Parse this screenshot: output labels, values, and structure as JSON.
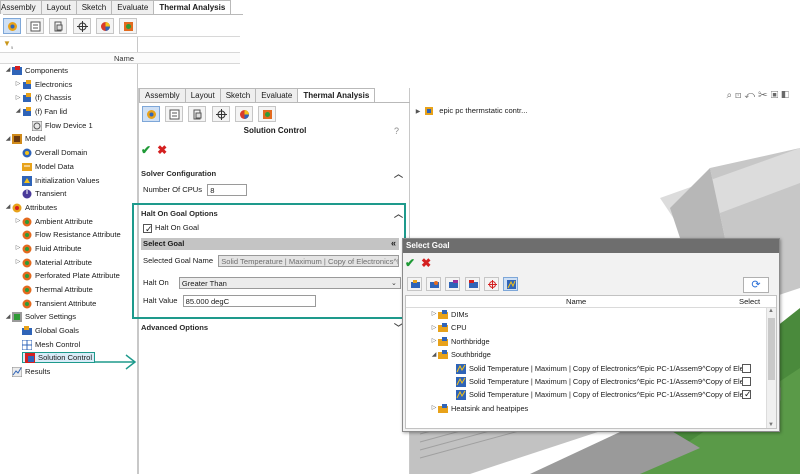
{
  "left_tabs": [
    "Assembly",
    "Layout",
    "Sketch",
    "Evaluate",
    "Thermal Analysis"
  ],
  "left_header": {
    "name_col": "Name"
  },
  "tree": [
    {
      "label": "Components",
      "level": 0,
      "exp": "◢",
      "icon": "components"
    },
    {
      "label": "Electronics",
      "level": 1,
      "exp": "▷",
      "icon": "part"
    },
    {
      "label": "(f) Chassis",
      "level": 1,
      "exp": "▷",
      "icon": "part"
    },
    {
      "label": "(f) Fan lid",
      "level": 1,
      "exp": "◢",
      "icon": "part"
    },
    {
      "label": "Flow Device 1",
      "level": 2,
      "exp": "",
      "icon": "fan"
    },
    {
      "label": "Model",
      "level": 0,
      "exp": "◢",
      "icon": "model"
    },
    {
      "label": "Overall Domain",
      "level": 1,
      "exp": "",
      "icon": "domain"
    },
    {
      "label": "Model Data",
      "level": 1,
      "exp": "",
      "icon": "data"
    },
    {
      "label": "Initialization Values",
      "level": 1,
      "exp": "",
      "icon": "init"
    },
    {
      "label": "Transient",
      "level": 1,
      "exp": "",
      "icon": "transient"
    },
    {
      "label": "Attributes",
      "level": 0,
      "exp": "◢",
      "icon": "attributes"
    },
    {
      "label": "Ambient Attribute",
      "level": 1,
      "exp": "▷",
      "icon": "attr"
    },
    {
      "label": "Flow Resistance Attribute",
      "level": 1,
      "exp": "",
      "icon": "attr"
    },
    {
      "label": "Fluid Attribute",
      "level": 1,
      "exp": "▷",
      "icon": "attr"
    },
    {
      "label": "Material Attribute",
      "level": 1,
      "exp": "▷",
      "icon": "attr"
    },
    {
      "label": "Perforated Plate Attribute",
      "level": 1,
      "exp": "",
      "icon": "attr"
    },
    {
      "label": "Thermal Attribute",
      "level": 1,
      "exp": "",
      "icon": "attr"
    },
    {
      "label": "Transient Attribute",
      "level": 1,
      "exp": "",
      "icon": "attr"
    },
    {
      "label": "Solver Settings",
      "level": 0,
      "exp": "◢",
      "icon": "solver"
    },
    {
      "label": "Global Goals",
      "level": 1,
      "exp": "",
      "icon": "goals"
    },
    {
      "label": "Mesh Control",
      "level": 1,
      "exp": "",
      "icon": "mesh"
    },
    {
      "label": "Solution Control",
      "level": 1,
      "exp": "",
      "icon": "solution",
      "selected": true
    },
    {
      "label": "Results",
      "level": 0,
      "exp": "",
      "icon": "results"
    }
  ],
  "pm": {
    "tabs": [
      "Assembly",
      "Layout",
      "Sketch",
      "Evaluate",
      "Thermal Analysis"
    ],
    "title": "Solution Control",
    "help": "?",
    "solver_config": {
      "heading": "Solver Configuration",
      "cpus_label": "Number Of CPUs",
      "cpus_value": "8"
    },
    "halt": {
      "heading": "Halt On Goal Options",
      "checkbox_label": "Halt On Goal",
      "select_goal_label": "Select Goal",
      "selected_goal_label": "Selected Goal Name",
      "selected_goal_value": "Solid Temperature | Maximum | Copy of Electronics^Epic P",
      "halt_on_label": "Halt On",
      "halt_on_value": "Greater Than",
      "halt_value_label": "Halt Value",
      "halt_value": "85.000 degC"
    },
    "advanced": {
      "heading": "Advanced Options"
    }
  },
  "viewport": {
    "tree_item": "epic pc thermstatic contr..."
  },
  "dialog": {
    "title": "Select Goal",
    "col_name": "Name",
    "col_select": "Select",
    "rows": [
      {
        "label": "DIMs",
        "level": 0,
        "exp": "▷",
        "kind": "folder"
      },
      {
        "label": "CPU",
        "level": 0,
        "exp": "▷",
        "kind": "folder"
      },
      {
        "label": "Northbridge",
        "level": 0,
        "exp": "▷",
        "kind": "folder"
      },
      {
        "label": "Southbridge",
        "level": 0,
        "exp": "◢",
        "kind": "folder"
      },
      {
        "label": "Solid Temperature | Maximum | Copy of Electronics^Epic PC-1/Assem9^Copy of Elec",
        "level": 1,
        "exp": "",
        "kind": "goal",
        "checked": false
      },
      {
        "label": "Solid Temperature | Maximum | Copy of Electronics^Epic PC-1/Assem9^Copy of Elec",
        "level": 1,
        "exp": "",
        "kind": "goal",
        "checked": false
      },
      {
        "label": "Solid Temperature | Maximum | Copy of Electronics^Epic PC-1/Assem9^Copy of Elec",
        "level": 1,
        "exp": "",
        "kind": "goal",
        "checked": true
      },
      {
        "label": "Heatsink and heatpipes",
        "level": 0,
        "exp": "▷",
        "kind": "folder"
      }
    ]
  },
  "colors": {
    "accent_frame": "#1e9a8c",
    "ok_green": "#1f9a36",
    "cancel_red": "#d42020",
    "dialog_title_bg": "#6e6e6e",
    "board_green": "#4a8a3c"
  }
}
